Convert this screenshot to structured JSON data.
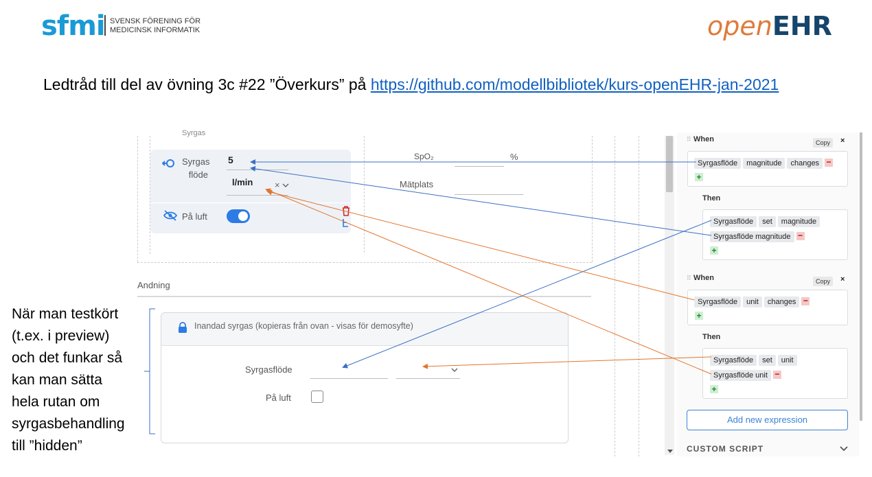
{
  "header": {
    "sfmi_logo": "sfmi",
    "sfmi_name_line1": "SVENSK FÖRENING FÖR",
    "sfmi_name_line2": "MEDICINSK INFORMATIK",
    "openehr_logo_open": "open",
    "openehr_logo_ehr": "EHR"
  },
  "headline": {
    "text": "Ledtråd till del av övning 3c #22 ”Överkurs” på ",
    "link": "https://github.com/modellbibliotek/kurs-openEHR-jan-2021"
  },
  "form": {
    "section_title_partial": "Syrgas",
    "oxygen_label_line1": "Syrgas",
    "oxygen_label_line2": "flöde",
    "oxygen_value": "5",
    "oxygen_unit": "l/min",
    "unit_clear": "×",
    "spo2_label": "SpO₂",
    "spo2_unit": "%",
    "measurement_site_label": "Mätplats",
    "room_air_label": "På luft",
    "breathing_section": "Andning",
    "card_title": "Inandad syrgas (kopieras från ovan - visas för demosyfte)",
    "card_flow_label": "Syrgasflöde",
    "card_room_air_label": "På luft"
  },
  "rules": [
    {
      "when_label": "When",
      "copy_label": "Copy",
      "close_label": "×",
      "when_chips": [
        "Syrgasflöde",
        "magnitude",
        "changes"
      ],
      "then_label": "Then",
      "then_row1": [
        "Syrgasflöde",
        "set",
        "magnitude"
      ],
      "then_row2": [
        "Syrgasflöde magnitude"
      ]
    },
    {
      "when_label": "When",
      "copy_label": "Copy",
      "close_label": "×",
      "when_chips": [
        "Syrgasflöde",
        "unit",
        "changes"
      ],
      "then_label": "Then",
      "then_row1": [
        "Syrgasflöde",
        "set",
        "unit"
      ],
      "then_row2": [
        "Syrgasflöde unit"
      ]
    }
  ],
  "add_expression_label": "Add new expression",
  "custom_script_label": "CUSTOM SCRIPT",
  "note_lines": [
    "När man testkört",
    "(t.ex. i preview)",
    "och det funkar så",
    "kan man sätta",
    "hela rutan om",
    "syrgasbehandling",
    "till ”hidden”"
  ],
  "colors": {
    "blue_arrow": "#3a6fc4",
    "orange_arrow": "#e4742c",
    "toggle": "#2d7be5",
    "sfmi_blue": "#1a9ad6",
    "openehr_orange": "#e07a3a",
    "openehr_navy": "#16456b"
  }
}
